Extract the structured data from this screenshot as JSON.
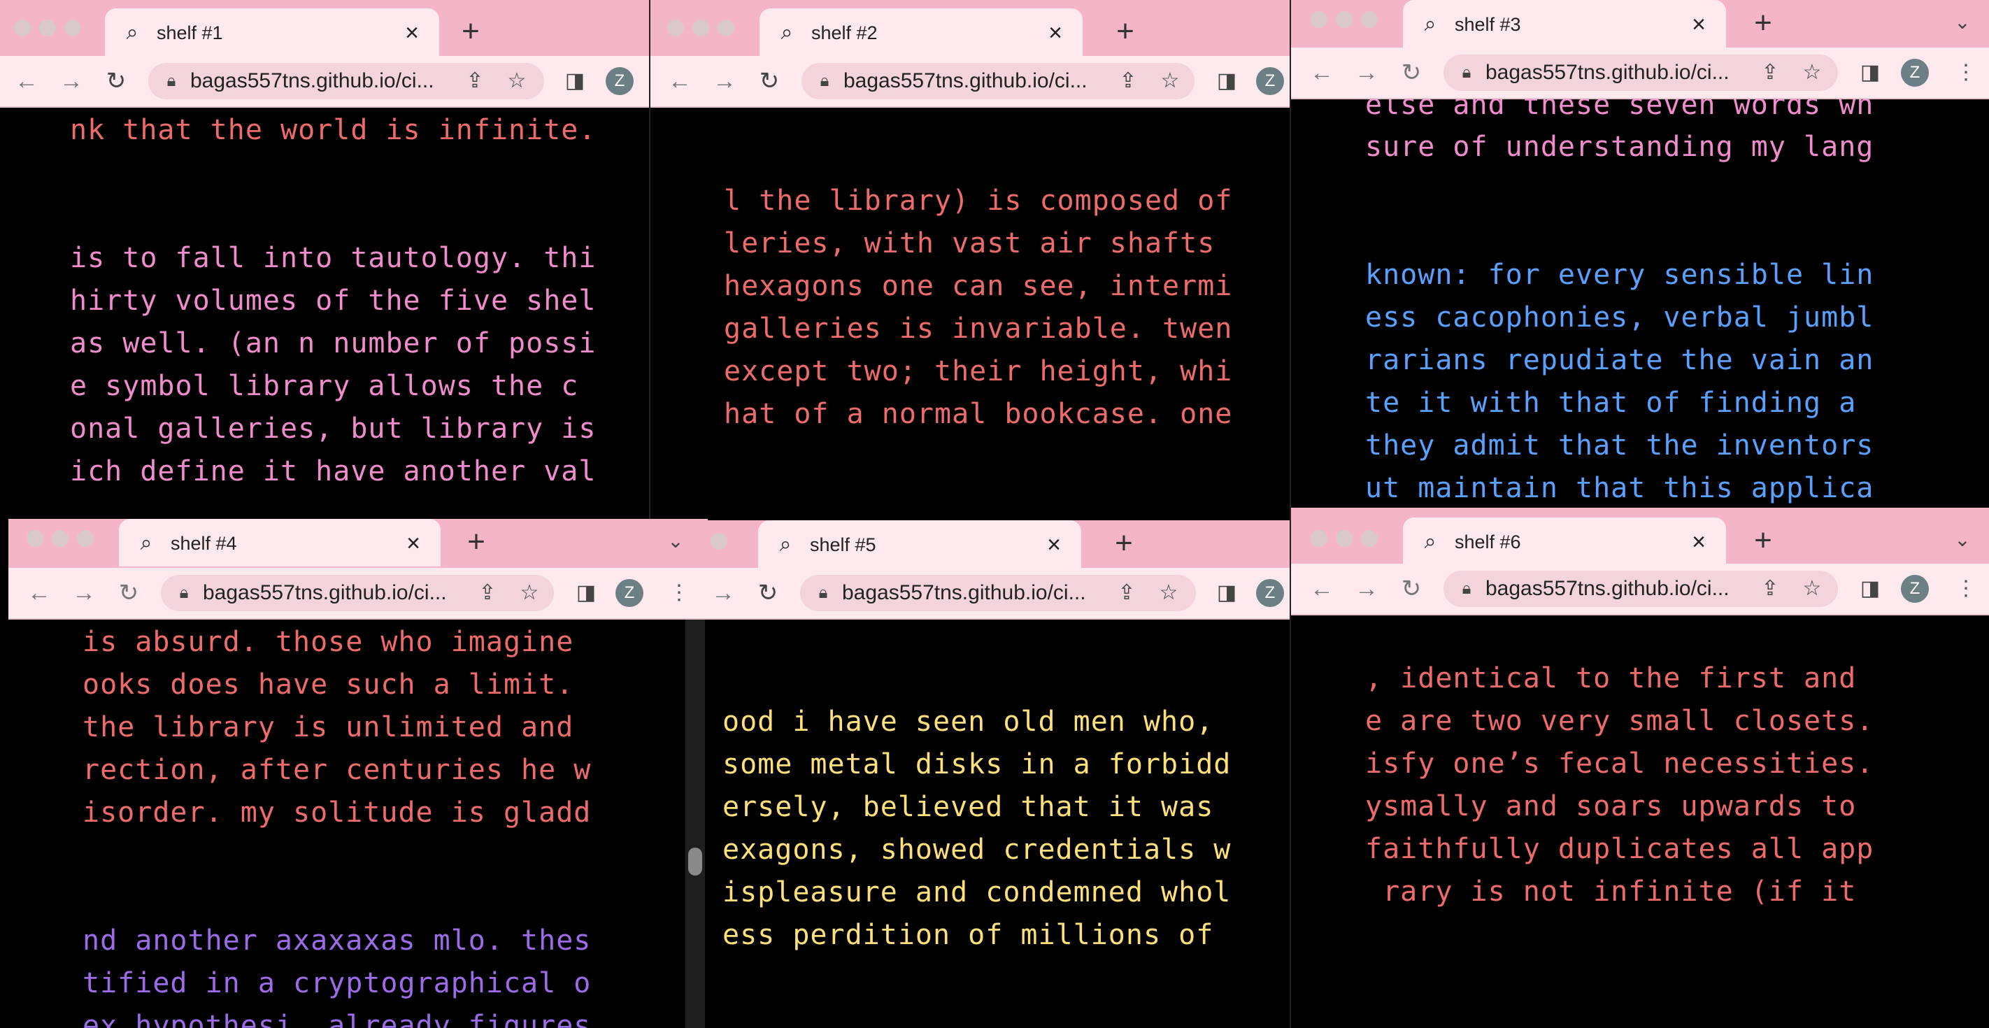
{
  "browser": {
    "url": "bagas557tns.github.io/ci...",
    "avatar_letter": "Z",
    "new_tab_symbol": "+",
    "close_symbol": "×",
    "back_symbol": "←",
    "forward_symbol": "→",
    "reload_symbol": "↻",
    "chevron_symbol": "⌄",
    "kebab_symbol": "⋮"
  },
  "colors": {
    "tab_bar": "#f4b6c6",
    "toolbar": "#fde9ee",
    "text_red": "#ee6b6b",
    "text_pink": "#f08ccc",
    "text_blue": "#5aa0ff",
    "text_purple": "#9b6be8",
    "text_yellow": "#fde07a"
  },
  "windows": [
    {
      "tab_title": "shelf #1",
      "paragraphs": [
        {
          "color": "red",
          "lines": [
            "nk that the world is infinite."
          ]
        },
        {
          "color": "pink",
          "lines": [
            "is to fall into tautology. thi",
            "hirty volumes of the five shel",
            "as well. (an n number of possi",
            "e symbol library allows the c",
            "onal galleries, but library is",
            "ich define it have another val"
          ]
        }
      ]
    },
    {
      "tab_title": "shelf #2",
      "paragraphs": [
        {
          "color": "red",
          "lines": [
            "l the library) is composed of",
            "leries, with vast air shafts",
            "hexagons one can see, intermi",
            "galleries is invariable. twen",
            "except two; their height, whi",
            "hat of a normal bookcase. one"
          ]
        }
      ]
    },
    {
      "tab_title": "shelf #3",
      "paragraphs": [
        {
          "color": "pink",
          "lines": [
            "else and these seven words wh",
            "sure of understanding my lang"
          ]
        },
        {
          "color": "blue",
          "lines": [
            "known: for every sensible lin",
            "ess cacophonies, verbal jumbl",
            "rarians repudiate the vain an",
            "te it with that of finding a",
            "they admit that the inventors",
            "ut maintain that this applica"
          ]
        }
      ]
    },
    {
      "tab_title": "shelf #4",
      "paragraphs": [
        {
          "color": "red",
          "lines": [
            "is absurd. those who imagine",
            "ooks does have such a limit.",
            "the library is unlimited and",
            "rection, after centuries he w",
            "isorder. my solitude is gladd"
          ]
        },
        {
          "color": "purple",
          "lines": [
            "nd another axaxaxas mlo. thes",
            "tified in a cryptographical o",
            "ex hypothesi, already figures"
          ]
        }
      ]
    },
    {
      "tab_title": "shelf #5",
      "paragraphs": [
        {
          "color": "yellow",
          "lines": [
            "ood i have seen old men who,",
            "some metal disks in a forbidd",
            "ersely, believed that it was",
            "exagons, showed credentials w",
            "ispleasure and condemned whol",
            "ess perdition of millions of"
          ]
        }
      ]
    },
    {
      "tab_title": "shelf #6",
      "paragraphs": [
        {
          "color": "red",
          "lines": [
            ", identical to the first and",
            "e are two very small closets.",
            "isfy one’s fecal necessities.",
            "ysmally and soars upwards to",
            "faithfully duplicates all app",
            " rary is not infinite (if it"
          ]
        }
      ]
    }
  ]
}
